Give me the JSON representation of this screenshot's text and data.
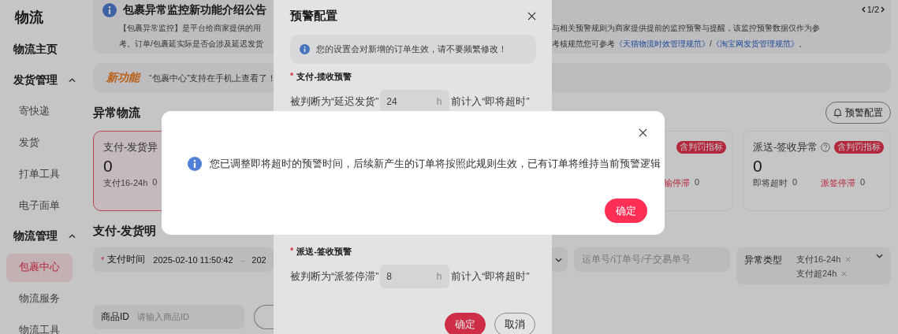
{
  "sidebar": {
    "title": "物流",
    "items": [
      {
        "label": "物流主页",
        "kind": "link",
        "selected": false
      },
      {
        "label": "发货管理",
        "kind": "group",
        "expanded": true,
        "children": [
          {
            "label": "寄快递",
            "selected": false
          },
          {
            "label": "发货",
            "selected": false
          },
          {
            "label": "打单工具",
            "selected": false
          },
          {
            "label": "电子面单",
            "selected": false
          }
        ]
      },
      {
        "label": "物流管理",
        "kind": "group",
        "expanded": true,
        "children": [
          {
            "label": "包裹中心",
            "selected": true
          },
          {
            "label": "物流服务",
            "selected": false
          },
          {
            "label": "物流工具",
            "selected": false
          }
        ]
      }
    ]
  },
  "notice": {
    "title": "包裹异常监控新功能介绍公告",
    "pager": "1/2",
    "left_lines": [
      "【包裹异常监控】是平台给商家提供的用",
      "考。订单/包裹延实际是否会涉及延迟发货"
    ],
    "right_lines": [
      "与相关预警规则为商家提供提前的监控预警与提醒，该监控预警数据仅作为参",
      "考核规范您可参考**《天猫物流时效管理规范》**/**《淘宝网发货管理规范》**。"
    ]
  },
  "feature_banner": {
    "tag": "新功能",
    "text": "“包裹中心”支持在手机上查看了！"
  },
  "abnormal": {
    "title": "异常物流",
    "config_button": "预警配置",
    "cards": [
      {
        "kind": "full",
        "selected": true,
        "title": "支付-发货异",
        "count": "0",
        "metrics": [
          {
            "label": "支付16-24h",
            "value": "0",
            "alert": false
          }
        ]
      },
      {
        "kind": "tail",
        "selected": false,
        "badge": "含判罚指标",
        "metrics": [
          {
            "label": "输停滞",
            "value": "0",
            "alert": true
          }
        ]
      },
      {
        "kind": "full",
        "selected": false,
        "title": "派送-签收异常",
        "help": true,
        "badge": "含判罚指标",
        "count": "0",
        "metrics": [
          {
            "label": "即将超时",
            "value": "0",
            "alert": false
          },
          {
            "label": "派签停滞",
            "value": "0",
            "alert": true
          }
        ]
      }
    ]
  },
  "detail": {
    "title": "支付-发货明",
    "time_filter": {
      "label": "支付时间",
      "required_mark": "*",
      "start": "2025-02-10 11:50:42",
      "separator": "-",
      "end": "202"
    },
    "search": {
      "placeholder": "运单号/订单号/子交易单号"
    },
    "type_filter": {
      "label": "异常类型",
      "tags": [
        "支付16-24h",
        "支付超24h"
      ]
    },
    "product_filter": {
      "label": "商品ID",
      "placeholder": "请输入商品ID"
    }
  },
  "config_modal": {
    "title": "预警配置",
    "notice": "您的设置会对新增的订单生效，请不要频繁修改！",
    "sections": [
      {
        "label": "支付-揽收预警",
        "required_mark": "*",
        "prefix": "被判断为“延迟发货”",
        "value": "24",
        "unit": "h",
        "suffix": "前计入“即将超时”"
      },
      {
        "label": "派送-签收预警",
        "required_mark": "*",
        "prefix": "被判断为“派签停滞”",
        "value": "8",
        "unit": "h",
        "suffix": "前计入“即将超时”"
      }
    ],
    "buttons": [
      {
        "label": "确定",
        "kind": "primary"
      },
      {
        "label": "取消",
        "kind": "default"
      }
    ]
  },
  "confirm_dialog": {
    "message": "您已调整即将超时的预警时间，后续新产生的订单将按照此规则生效，已有订单将维持当前预警逻辑",
    "button": "确定"
  }
}
